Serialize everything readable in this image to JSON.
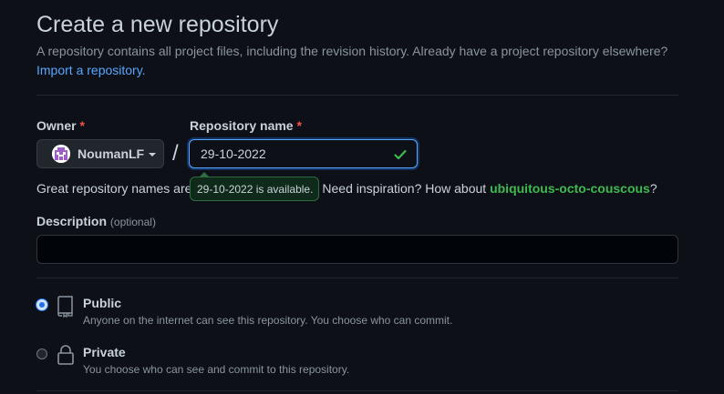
{
  "header": {
    "title": "Create a new repository",
    "subtitle": "A repository contains all project files, including the revision history. Already have a project repository elsewhere?",
    "import_link": "Import a repository."
  },
  "owner": {
    "label": "Owner",
    "required_mark": "*",
    "name": "NoumanLF",
    "avatar_icon": "identicon-avatar"
  },
  "separator": "/",
  "repo": {
    "label": "Repository name",
    "required_mark": "*",
    "value": "29-10-2022",
    "status_icon": "check-icon",
    "tooltip": "29-10-2022 is available."
  },
  "hint": {
    "prefix": "Great repository names are",
    "middle": "Need inspiration? How about",
    "suggestion": "ubiquitous-octo-couscous",
    "suffix": "?"
  },
  "description": {
    "label": "Description",
    "optional": "(optional)",
    "value": ""
  },
  "visibility": {
    "options": [
      {
        "title": "Public",
        "desc": "Anyone on the internet can see this repository. You choose who can commit.",
        "icon": "repo-icon",
        "selected": true
      },
      {
        "title": "Private",
        "desc": "You choose who can see and commit to this repository.",
        "icon": "lock-icon",
        "selected": false
      }
    ]
  },
  "colors": {
    "background": "#0d1117",
    "accent": "#58a6ff",
    "success": "#3fb950",
    "danger": "#f85149"
  }
}
